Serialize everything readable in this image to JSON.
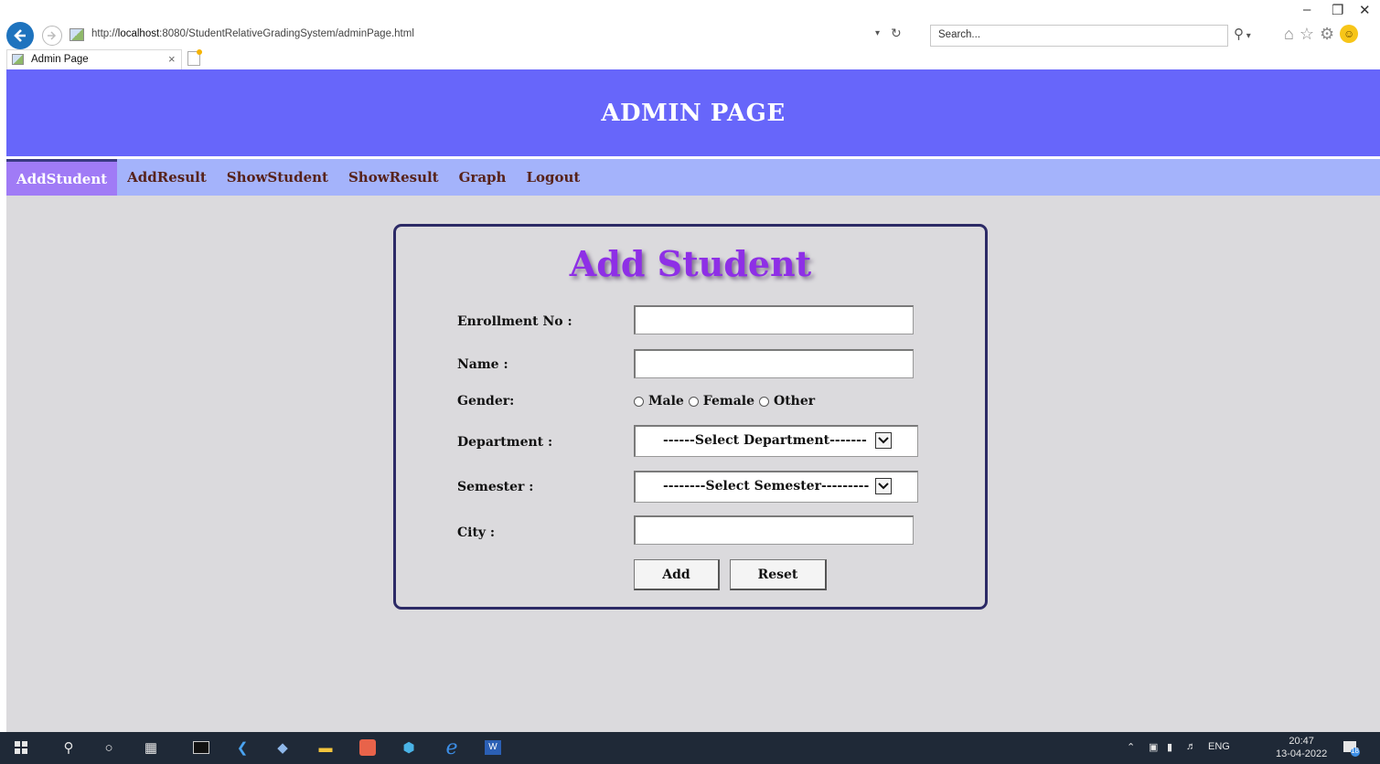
{
  "browser": {
    "url_prefix": "http://",
    "url_host": "localhost",
    "url_rest": ":8080/StudentRelativeGradingSystem/adminPage.html",
    "search_placeholder": "Search...",
    "tab_title": "Admin Page",
    "tab_close": "×"
  },
  "page": {
    "banner_title": "ADMIN PAGE",
    "nav": [
      "AddStudent",
      "AddResult",
      "ShowStudent",
      "ShowResult",
      "Graph",
      "Logout"
    ],
    "active_nav": "AddStudent"
  },
  "form": {
    "title": "Add Student",
    "enrollment_label": "Enrollment No :",
    "enrollment_value": "",
    "name_label": "Name :",
    "name_value": "",
    "gender_label": "Gender:",
    "gender_options": [
      "Male",
      "Female",
      "Other"
    ],
    "department_label": "Department :",
    "department_selected": "------Select Department-------",
    "semester_label": "Semester :",
    "semester_selected": "--------Select Semester---------",
    "city_label": "City :",
    "city_value": "",
    "add_label": "Add",
    "reset_label": "Reset"
  },
  "taskbar": {
    "language": "ENG",
    "time": "20:47",
    "date": "13-04-2022",
    "notification_count": "18"
  },
  "colors": {
    "banner": "#6766fa",
    "nav": "#a4b3fb",
    "nav_active": "#a07bf6",
    "nav_text": "#57221a",
    "title": "#8e2fe6",
    "page_bg": "#dbdadd"
  }
}
